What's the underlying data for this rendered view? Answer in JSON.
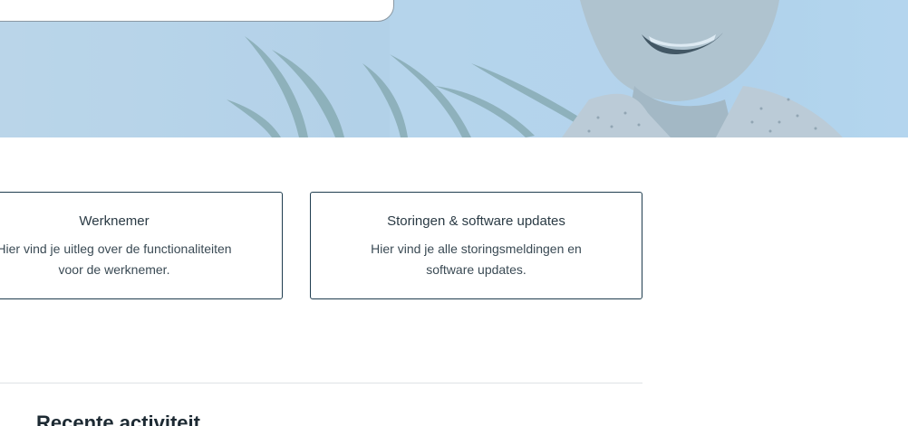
{
  "cards": [
    {
      "title": "Werknemer",
      "description": "Hier vind je uitleg over de functionaliteiten voor de werknemer."
    },
    {
      "title": "Storingen & software updates",
      "description": "Hier vind je alle storingsmeldingen en software updates."
    }
  ],
  "recent": {
    "title": "Recente activiteit"
  }
}
